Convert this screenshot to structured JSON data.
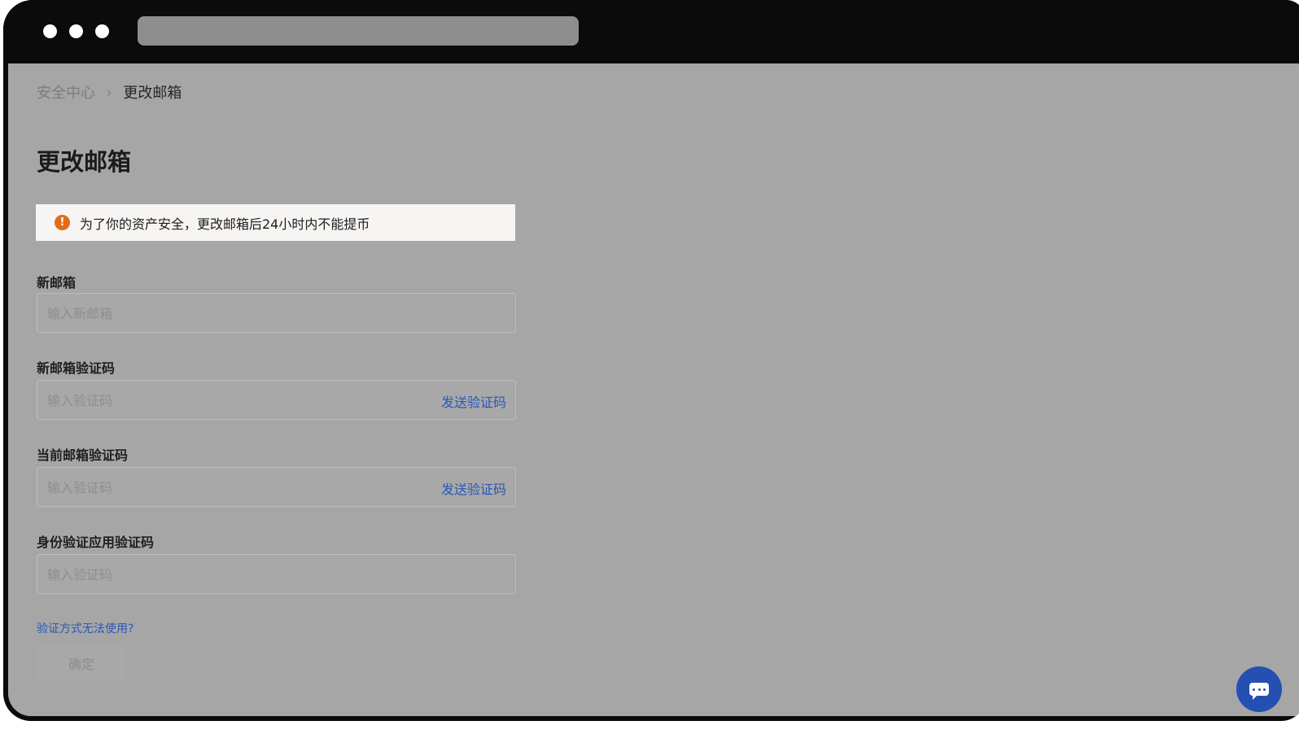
{
  "breadcrumb": {
    "root": "安全中心",
    "separator": "›",
    "current": "更改邮箱"
  },
  "page": {
    "title": "更改邮箱"
  },
  "notice": {
    "icon": "warning-icon",
    "text": "为了你的资产安全，更改邮箱后24小时内不能提币"
  },
  "form": {
    "new_email": {
      "label": "新邮箱",
      "placeholder": "输入新邮箱"
    },
    "new_email_code": {
      "label": "新邮箱验证码",
      "placeholder": "输入验证码",
      "action": "发送验证码"
    },
    "current_email_code": {
      "label": "当前邮箱验证码",
      "placeholder": "输入验证码",
      "action": "发送验证码"
    },
    "authenticator_code": {
      "label": "身份验证应用验证码",
      "placeholder": "输入验证码"
    },
    "help_link": "验证方式无法使用?",
    "submit": "确定"
  },
  "colors": {
    "accent": "#2a57b8",
    "warning": "#e36c1a",
    "overlay": "#a6a6a6",
    "chrome": "#0b0b0b"
  },
  "chat": {
    "icon": "chat-icon"
  }
}
